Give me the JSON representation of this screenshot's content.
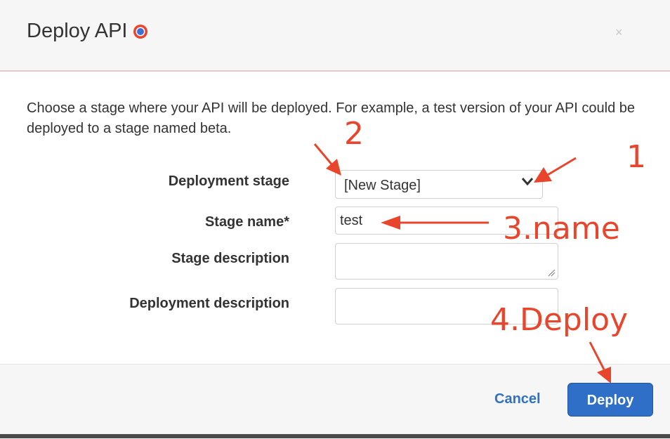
{
  "dialog": {
    "title": "Deploy API",
    "close_glyph": "×",
    "help_icon": "help-circle-icon",
    "description": "Choose a stage where your API will be deployed. For example, a test version of your API could be deployed to a stage named beta."
  },
  "form": {
    "deployment_stage": {
      "label": "Deployment stage",
      "value": "[New Stage]"
    },
    "stage_name": {
      "label": "Stage name*",
      "value": "test"
    },
    "stage_description": {
      "label": "Stage description",
      "value": ""
    },
    "deployment_description": {
      "label": "Deployment description",
      "value": ""
    }
  },
  "footer": {
    "cancel_label": "Cancel",
    "deploy_label": "Deploy"
  },
  "annotations": {
    "step1": "1",
    "step2": "2",
    "step3": "3.name",
    "step4": "4.Deploy"
  },
  "colors": {
    "annotation": "#e8452c",
    "primary_button": "#2f6fc8",
    "link": "#2f72c4"
  }
}
